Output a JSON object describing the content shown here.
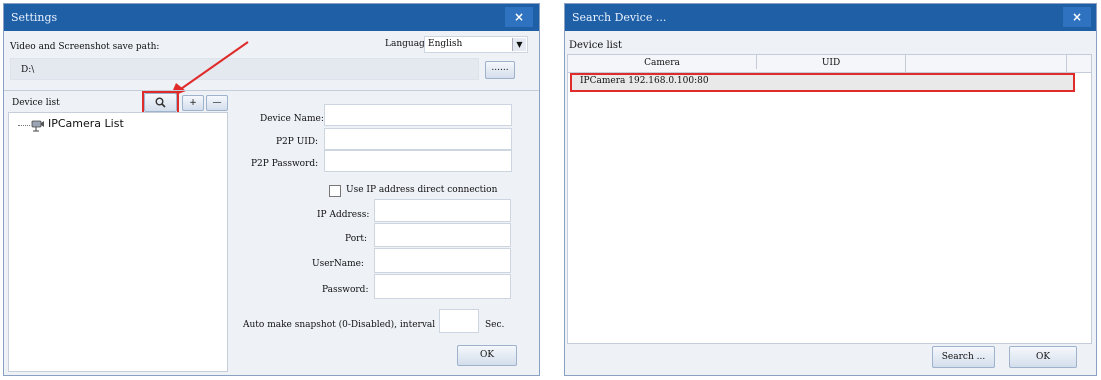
{
  "settings_window": {
    "title": "Settings",
    "close_glyph": "×",
    "path_label": "Video and Screenshot save path:",
    "path_value": "D:\\",
    "browse_label": "......",
    "language_label": "Language",
    "language_value": "English",
    "device_list_label": "Device list",
    "search_button_glyph": "🔍",
    "add_button_label": "+",
    "remove_button_label": "—",
    "tree_root_label": "IPCamera List",
    "device_name_label": "Device Name:",
    "p2p_uid_label": "P2P UID:",
    "p2p_password_label": "P2P Password:",
    "use_ip_label": "Use IP address direct connection",
    "ip_address_label": "IP Address:",
    "port_label": "Port:",
    "username_label": "UserName:",
    "password_label": "Password:",
    "snapshot_label": "Auto make snapshot (0-Disabled), interval",
    "sec_label": "Sec.",
    "ok_label": "OK"
  },
  "search_window": {
    "title": "Search Device ...",
    "close_glyph": "×",
    "device_list_label": "Device list",
    "columns": [
      "Camera",
      "UID",
      ""
    ],
    "rows": [
      {
        "camera": "IPCamera 192.168.0.100:80",
        "uid": ""
      }
    ],
    "search_button_label": "Search ...",
    "ok_label": "OK"
  },
  "colors": {
    "titlebar": "#1f5fa6",
    "highlight": "#e02b2b",
    "panel_bg": "#eef1f6"
  },
  "icons": {
    "search": "search-icon",
    "camera": "camera-icon",
    "close": "close-icon",
    "dropdown": "chevron-down-icon",
    "arrow": "red-arrow-annotation"
  }
}
